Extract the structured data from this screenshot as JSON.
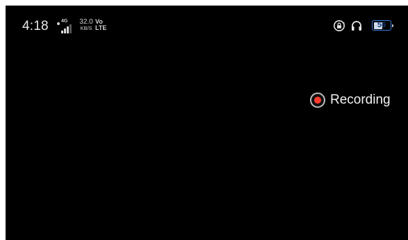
{
  "status_bar": {
    "time": "4:18",
    "network_type": "4G",
    "signal_bars": 3,
    "speed_value": "32.0",
    "speed_unit": "KB/S",
    "volte_top": "Vo",
    "volte_bottom": "LTE",
    "icons": [
      "rotation-lock-icon",
      "headphones-icon"
    ],
    "battery_level": "56",
    "battery_color": "#3b7be0"
  },
  "recording": {
    "label": "Recording",
    "dot_color": "#ff3b30"
  }
}
